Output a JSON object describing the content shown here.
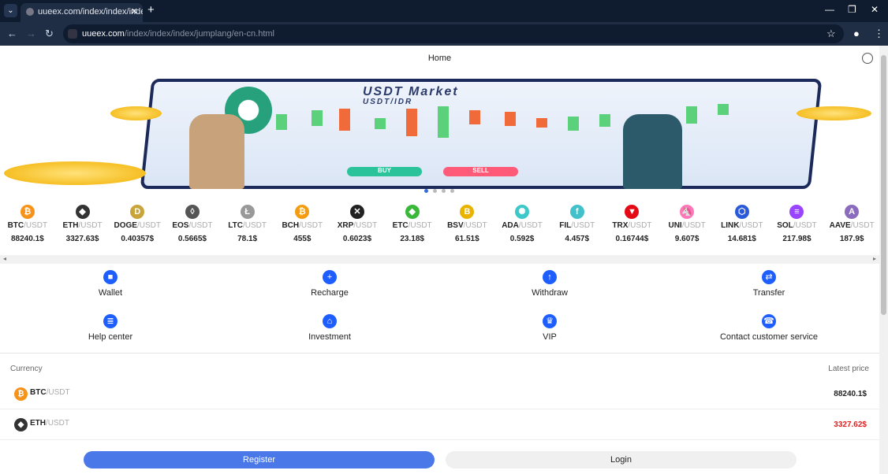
{
  "browser": {
    "tab_title": "uueex.com/index/index/index/j",
    "url_domain": "uueex.com",
    "url_path": "/index/index/index/jumplang/en-cn.html"
  },
  "header": {
    "title": "Home",
    "globe_icon": "globe-icon"
  },
  "banner": {
    "title": "USDT Market",
    "subtitle": "USDT/IDR",
    "buy": "BUY",
    "sell": "SELL",
    "slide_count": 4,
    "active_slide": 1
  },
  "ticker": [
    {
      "base": "BTC",
      "quote": "/USDT",
      "price": "88240.1$",
      "color": "#f7931a",
      "glyph": "₿"
    },
    {
      "base": "ETH",
      "quote": "/USDT",
      "price": "3327.63$",
      "color": "#333",
      "glyph": "◆"
    },
    {
      "base": "DOGE",
      "quote": "/USDT",
      "price": "0.40357$",
      "color": "#c8a43a",
      "glyph": "D"
    },
    {
      "base": "EOS",
      "quote": "/USDT",
      "price": "0.5665$",
      "color": "#555",
      "glyph": "◊"
    },
    {
      "base": "LTC",
      "quote": "/USDT",
      "price": "78.1$",
      "color": "#999",
      "glyph": "Ł"
    },
    {
      "base": "BCH",
      "quote": "/USDT",
      "price": "455$",
      "color": "#f39c12",
      "glyph": "₿"
    },
    {
      "base": "XRP",
      "quote": "/USDT",
      "price": "0.6023$",
      "color": "#222",
      "glyph": "✕"
    },
    {
      "base": "ETC",
      "quote": "/USDT",
      "price": "23.18$",
      "color": "#3ab83a",
      "glyph": "◆"
    },
    {
      "base": "BSV",
      "quote": "/USDT",
      "price": "61.51$",
      "color": "#eab300",
      "glyph": "B"
    },
    {
      "base": "ADA",
      "quote": "/USDT",
      "price": "0.592$",
      "color": "#3cc8c8",
      "glyph": "✺"
    },
    {
      "base": "FIL",
      "quote": "/USDT",
      "price": "4.457$",
      "color": "#42c1ca",
      "glyph": "f"
    },
    {
      "base": "TRX",
      "quote": "/USDT",
      "price": "0.16744$",
      "color": "#e50915",
      "glyph": "▼"
    },
    {
      "base": "UNI",
      "quote": "/USDT",
      "price": "9.607$",
      "color": "#ff77b8",
      "glyph": "🦄"
    },
    {
      "base": "LINK",
      "quote": "/USDT",
      "price": "14.681$",
      "color": "#2a5ada",
      "glyph": "⬡"
    },
    {
      "base": "SOL",
      "quote": "/USDT",
      "price": "217.98$",
      "color": "#9945ff",
      "glyph": "≡"
    },
    {
      "base": "AAVE",
      "quote": "/USDT",
      "price": "187.9$",
      "color": "#8a6bbd",
      "glyph": "A"
    }
  ],
  "menu": [
    {
      "label": "Wallet",
      "icon": "wallet-icon",
      "glyph": "■"
    },
    {
      "label": "Recharge",
      "icon": "plus-icon",
      "glyph": "+"
    },
    {
      "label": "Withdraw",
      "icon": "arrow-up-icon",
      "glyph": "↑"
    },
    {
      "label": "Transfer",
      "icon": "transfer-icon",
      "glyph": "⇄"
    },
    {
      "label": "Help center",
      "icon": "document-icon",
      "glyph": "≣"
    },
    {
      "label": "Investment",
      "icon": "bank-icon",
      "glyph": "⌂"
    },
    {
      "label": "VIP",
      "icon": "crown-icon",
      "glyph": "♛"
    },
    {
      "label": "Contact customer service",
      "icon": "headset-icon",
      "glyph": "☎"
    }
  ],
  "market": {
    "currency_header": "Currency",
    "price_header": "Latest price",
    "rows": [
      {
        "base": "BTC",
        "quote": "/USDT",
        "price": "88240.1$",
        "price_color": "#222",
        "color": "#f7931a",
        "glyph": "₿"
      },
      {
        "base": "ETH",
        "quote": "/USDT",
        "price": "3327.62$",
        "price_color": "#e02020",
        "color": "#333",
        "glyph": "◆"
      }
    ]
  },
  "actions": {
    "register": "Register",
    "login": "Login"
  },
  "colors": {
    "accent": "#1e5eff",
    "register_bg": "#4a78e8",
    "down": "#e02020"
  }
}
